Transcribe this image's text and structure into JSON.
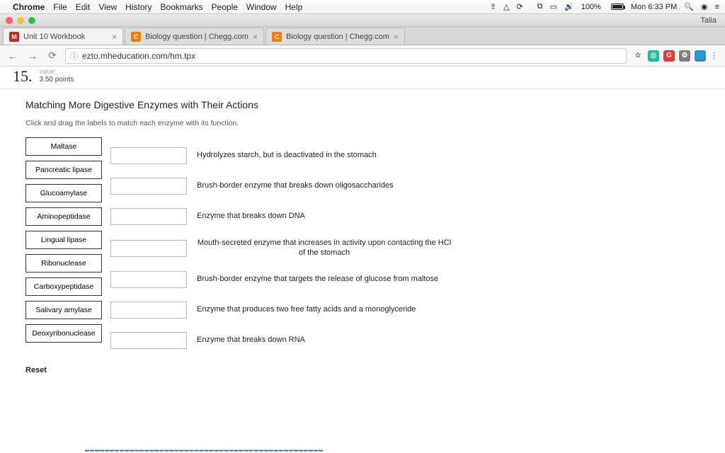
{
  "menubar": {
    "app": "Chrome",
    "items": [
      "File",
      "Edit",
      "View",
      "History",
      "Bookmarks",
      "People",
      "Window",
      "Help"
    ],
    "battery": "100%",
    "clock": "Mon 6:33 PM"
  },
  "window": {
    "user": "Talia"
  },
  "tabs": [
    {
      "title": "Unit 10 Workbook",
      "favicon": "M",
      "favClass": "fav-m",
      "active": true
    },
    {
      "title": "Biology question | Chegg.com",
      "favicon": "C",
      "favClass": "fav-c",
      "active": false
    },
    {
      "title": "Biology question | Chegg.com",
      "favicon": "C",
      "favClass": "fav-c",
      "active": false
    }
  ],
  "url": "ezto.mheducation.com/hm.tpx",
  "question": {
    "number": "15.",
    "value_label": "value:",
    "points": "3.50 points",
    "title": "Matching More Digestive Enzymes with Their Actions",
    "instruction": "Click and drag the labels to match each enzyme with its function.",
    "labels": [
      "Maltase",
      "Pancreatic lipase",
      "Glucoamylase",
      "Aminopeptidase",
      "Lingual lipase",
      "Ribonuclease",
      "Carboxypeptidase",
      "Salivary amylase",
      "Deoxyribonuclease"
    ],
    "functions": [
      "Hydrolyzes starch, but is deactivated in the stomach",
      "Brush-border enzyme that breaks down oligosaccharides",
      "Enzyme that breaks down DNA",
      "Mouth-secreted enzyme that increases in activity upon contacting the HCl of the stomach",
      "Brush-border enzyme that targets the release of glucose from maltose",
      "Enzyme that produces two free fatty acids and a monoglyceride",
      "Enzyme that breaks down RNA"
    ],
    "reset": "Reset"
  }
}
